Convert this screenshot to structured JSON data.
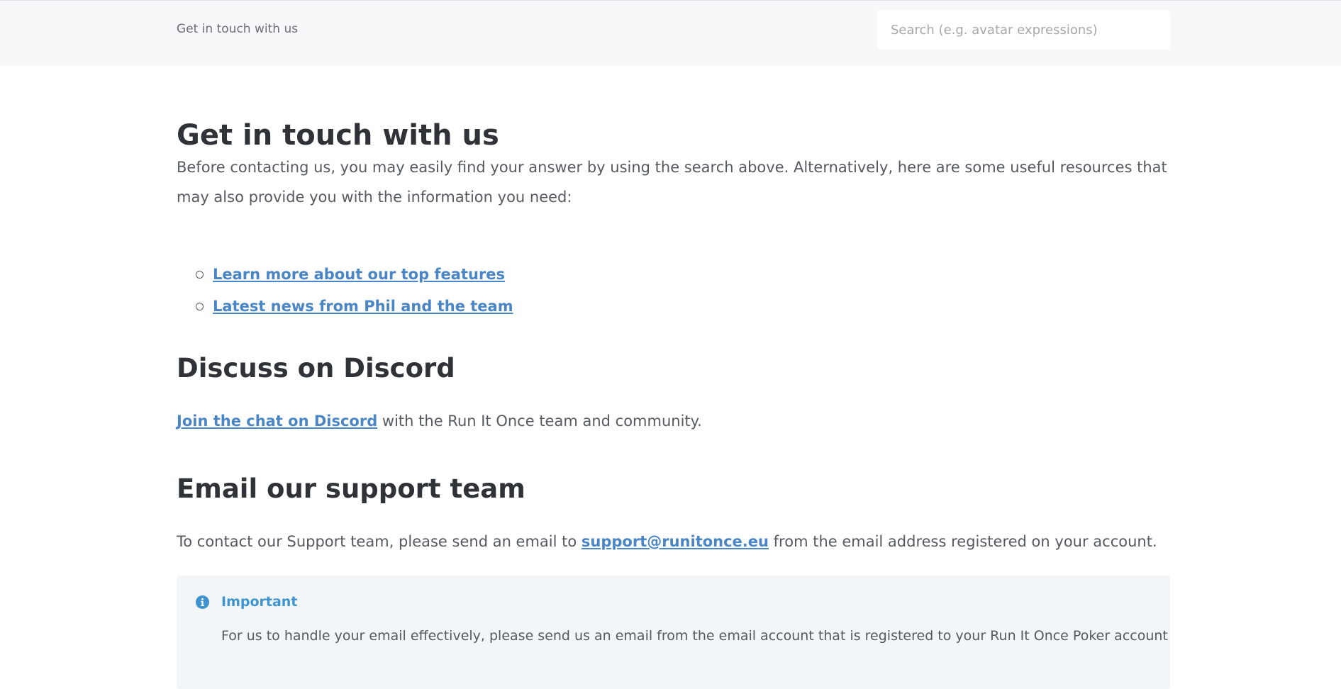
{
  "header": {
    "breadcrumb": "Get in touch with us",
    "search_placeholder": "Search (e.g. avatar expressions)"
  },
  "main": {
    "title": "Get in touch with us",
    "intro": "Before contacting us, you may easily find your answer by using the search above. Alternatively, here are some useful resources that may also provide you with the information you need:",
    "resources": [
      {
        "label": "Learn more about our top features"
      },
      {
        "label": "Latest news from Phil and the team"
      }
    ],
    "discord": {
      "heading": "Discuss on Discord",
      "link_label": "Join the chat on Discord",
      "text_after": " with the Run It Once team and community."
    },
    "email": {
      "heading": "Email our support team",
      "text_before": "To contact our Support team, please send an email to ",
      "email_link": "support@runitonce.eu",
      "text_after": " from the email address registered on your account."
    },
    "callout": {
      "icon": "info-circle-icon",
      "title": "Important",
      "text": "For us to handle your email effectively, please send us an email from the email account that is registered to your Run It Once Poker account"
    }
  },
  "colors": {
    "link": "#4a86c5",
    "heading": "#2f3337",
    "body": "#555a60",
    "callout_title": "#3e93d0",
    "callout_bg": "#f2f6f9",
    "header_bg": "#f7f8f9"
  }
}
